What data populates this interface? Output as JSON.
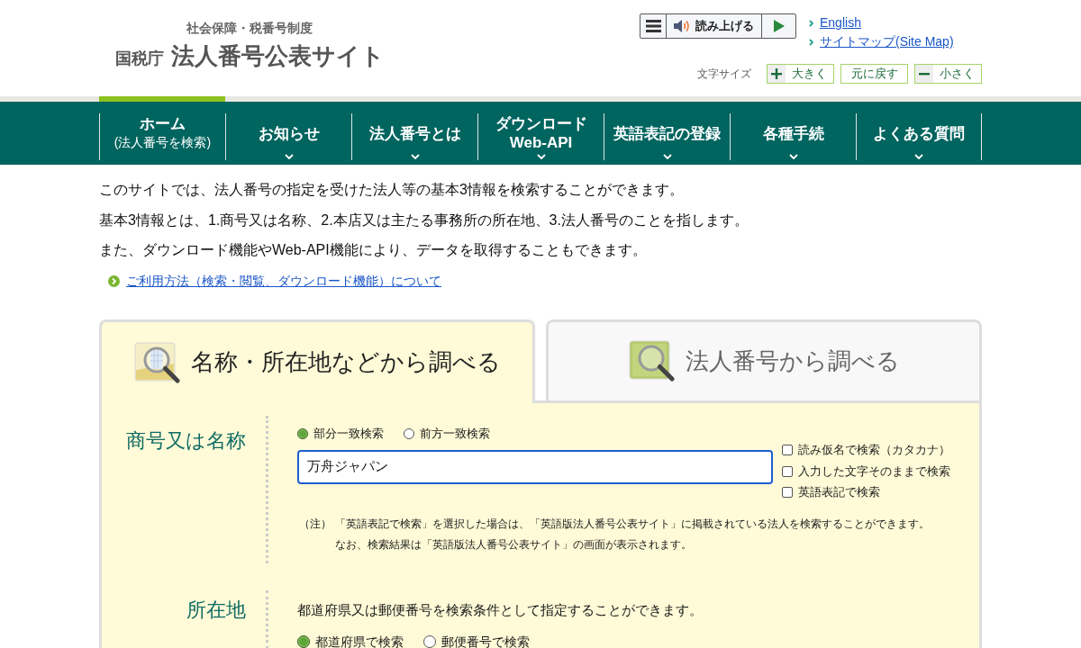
{
  "header": {
    "logo": {
      "tagline": "社会保障・税番号制度",
      "agency": "国税庁",
      "site_name": "法人番号公表サイト"
    },
    "read_aloud": {
      "label": "読み上げる"
    },
    "links": [
      "English",
      "サイトマップ(Site Map)"
    ],
    "font_size": {
      "label": "文字サイズ",
      "buttons": [
        {
          "kind": "plus",
          "label": "大きく"
        },
        {
          "kind": "reset",
          "label": "元に戻す"
        },
        {
          "kind": "minus",
          "label": "小さく"
        }
      ]
    }
  },
  "nav": [
    {
      "lines": [
        "ホーム"
      ],
      "sublabel": "(法人番号を検索)",
      "selected": true,
      "dropdown": false
    },
    {
      "lines": [
        "お知らせ"
      ],
      "selected": false,
      "dropdown": true
    },
    {
      "lines": [
        "法人番号とは"
      ],
      "selected": false,
      "dropdown": true
    },
    {
      "lines": [
        "ダウンロード",
        "Web-API"
      ],
      "selected": false,
      "dropdown": true
    },
    {
      "lines": [
        "英語表記の登録"
      ],
      "selected": false,
      "dropdown": true
    },
    {
      "lines": [
        "各種手続"
      ],
      "selected": false,
      "dropdown": true
    },
    {
      "lines": [
        "よくある質問"
      ],
      "selected": false,
      "dropdown": true
    }
  ],
  "intro": {
    "paragraphs": [
      "このサイトでは、法人番号の指定を受けた法人等の基本3情報を検索することができます。",
      "基本3情報とは、1.商号又は名称、2.本店又は主たる事務所の所在地、3.法人番号のことを指します。",
      "また、ダウンロード機能やWeb-API機能により、データを取得することもできます。"
    ],
    "help_link": "ご利用方法（検索・閲覧、ダウンロード機能）について"
  },
  "search_tabs": [
    {
      "kind": "name",
      "label": "名称・所在地などから調べる",
      "selected": true
    },
    {
      "kind": "number",
      "label": "法人番号から調べる",
      "selected": false
    }
  ],
  "name_section": {
    "label": "商号又は名称",
    "match_options": [
      {
        "label": "部分一致検索",
        "selected": true
      },
      {
        "label": "前方一致検索",
        "selected": false
      }
    ],
    "value": "万舟ジャパン",
    "options": [
      {
        "label": "読み仮名で検索（カタカナ）",
        "checked": false
      },
      {
        "label": "入力した文字そのままで検索",
        "checked": false
      },
      {
        "label": "英語表記で検索",
        "checked": false
      }
    ],
    "note": {
      "marker": "（注）",
      "lines": [
        "「英語表記で検索」を選択した場合は、「英語版法人番号公表サイト」に掲載されている法人を検索することができます。",
        "なお、検索結果は「英語版法人番号公表サイト」の画面が表示されます。"
      ]
    }
  },
  "location_section": {
    "label": "所在地",
    "description": "都道府県又は郵便番号を検索条件として指定することができます。",
    "search_by": [
      {
        "label": "都道府県で検索",
        "selected": true
      },
      {
        "label": "郵便番号で検索",
        "selected": false
      }
    ]
  }
}
